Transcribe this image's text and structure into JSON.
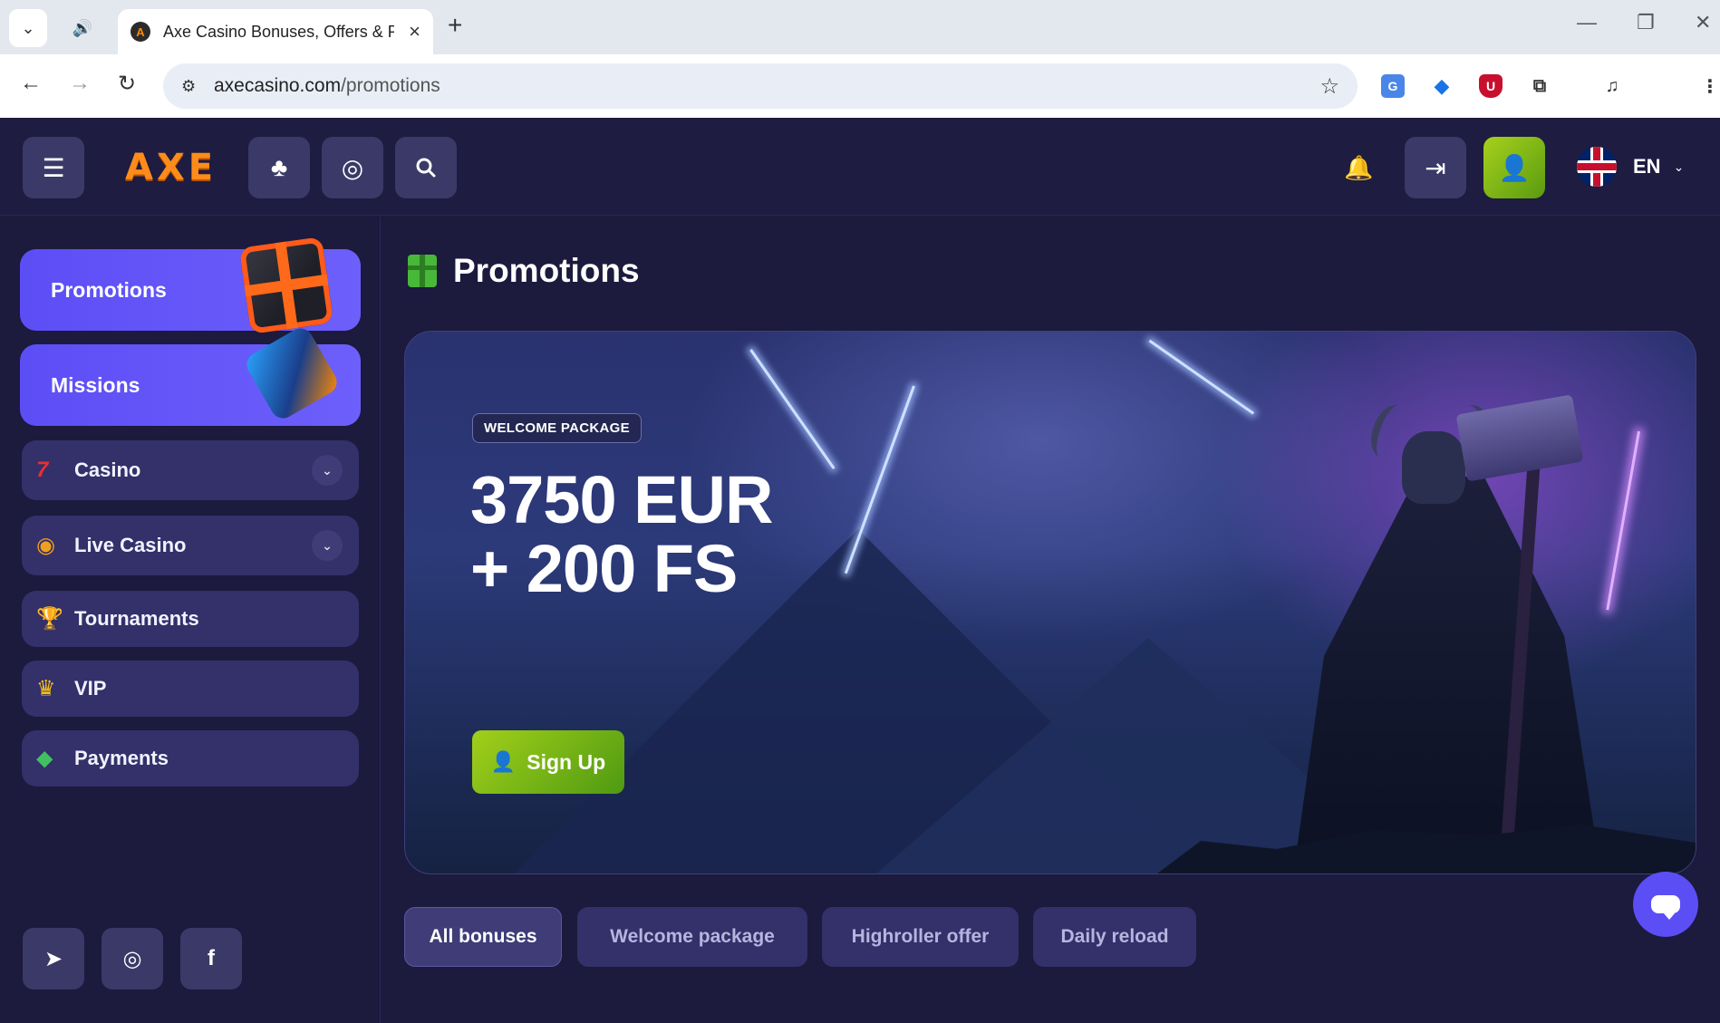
{
  "browser": {
    "tab_title": "Axe Casino Bonuses, Offers & P",
    "tab_favicon": "A",
    "url_host": "axecasino.com",
    "url_path": "/promotions",
    "icons": [
      "tab-list-icon",
      "sound-icon",
      "close-icon",
      "new-tab-icon",
      "back-icon",
      "forward-icon",
      "reload-icon",
      "site-settings-icon",
      "bookmark-star-icon",
      "translate-icon",
      "download-icon",
      "ublock-icon",
      "extensions-icon",
      "media-icon",
      "more-icon",
      "minimize-icon",
      "restore-icon",
      "window-close-icon"
    ]
  },
  "header": {
    "logo_text": "AXE",
    "language_code": "EN",
    "icons": [
      "menu-icon",
      "clubs-icon",
      "roulette-icon",
      "search-icon",
      "bell-icon",
      "login-icon",
      "add-user-icon",
      "uk-flag-icon",
      "chevron-down-icon"
    ]
  },
  "sidebar": {
    "cards": [
      {
        "label": "Promotions",
        "icon": "gift-icon"
      },
      {
        "label": "Missions",
        "icon": "hammer-icon"
      }
    ],
    "items": [
      {
        "label": "Casino",
        "icon": "seven-icon",
        "expandable": true
      },
      {
        "label": "Live Casino",
        "icon": "chip-icon",
        "expandable": true
      },
      {
        "label": "Tournaments",
        "icon": "trophy-icon",
        "expandable": false
      },
      {
        "label": "VIP",
        "icon": "crown-icon",
        "expandable": false
      },
      {
        "label": "Payments",
        "icon": "wallet-icon",
        "expandable": false
      }
    ],
    "social": [
      "telegram-icon",
      "instagram-icon",
      "facebook-icon"
    ]
  },
  "main": {
    "title": "Promotions",
    "banner": {
      "badge": "WELCOME PACKAGE",
      "headline_line1": "3750 EUR",
      "headline_line2": "+ 200 FS",
      "cta_label": "Sign Up"
    },
    "filters": [
      {
        "label": "All bonuses",
        "active": true
      },
      {
        "label": "Welcome package",
        "active": false
      },
      {
        "label": "Highroller offer",
        "active": false
      },
      {
        "label": "Daily reload",
        "active": false
      }
    ]
  },
  "colors": {
    "page_bg": "#1c1a3d",
    "accent_purple": "#5c4ef5",
    "accent_green": "#8cc11a",
    "menu_item_bg": "#33306a",
    "logo_orange": "#ff8c1a"
  }
}
